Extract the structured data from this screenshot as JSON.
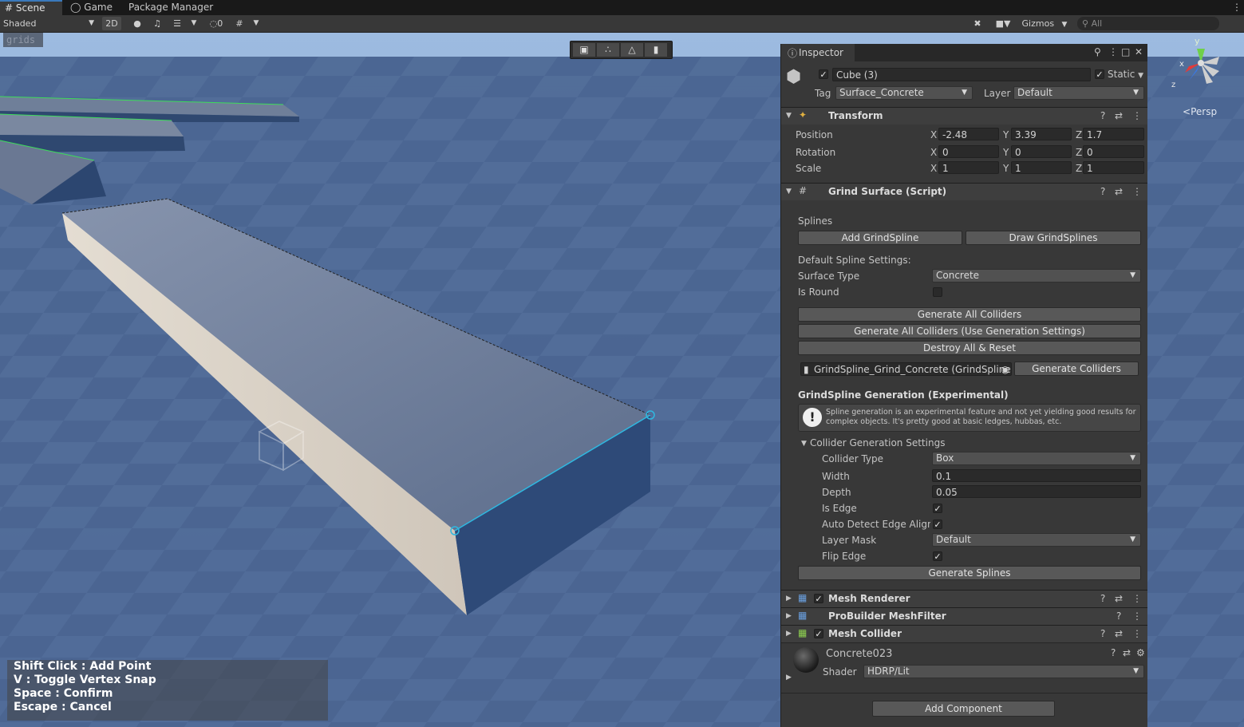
{
  "tabs": [
    {
      "icon": "grid-icon",
      "label": "Scene",
      "active": true
    },
    {
      "icon": "gamepad-icon",
      "label": "Game",
      "active": false
    },
    {
      "icon": "",
      "label": "Package Manager",
      "active": false
    }
  ],
  "toolbar": {
    "shading_mode": "Shaded",
    "toggle_2d": "2D",
    "hidden_count": "0",
    "gizmos_label": "Gizmos",
    "search_placeholder": "All"
  },
  "scene": {
    "overlay_label": "grids",
    "persp_label": "Persp",
    "axis_y": "y",
    "axis_x": "x",
    "axis_z": "z",
    "hints": [
      "Shift Click : Add Point",
      "V : Toggle Vertex Snap",
      "Space : Confirm",
      "Escape : Cancel"
    ]
  },
  "inspector": {
    "tab_label": "Inspector",
    "object_name": "Cube (3)",
    "static_label": "Static",
    "tag_label": "Tag",
    "tag_value": "Surface_Concrete",
    "layer_label": "Layer",
    "layer_value": "Default",
    "transform": {
      "title": "Transform",
      "position_label": "Position",
      "rotation_label": "Rotation",
      "scale_label": "Scale",
      "position": {
        "x": "-2.48",
        "y": "3.39",
        "z": "1.7"
      },
      "rotation": {
        "x": "0",
        "y": "0",
        "z": "0"
      },
      "scale": {
        "x": "1",
        "y": "1",
        "z": "1"
      },
      "x_label": "X",
      "y_label": "Y",
      "z_label": "Z"
    },
    "grind": {
      "title": "Grind Surface (Script)",
      "splines_label": "Splines",
      "add_btn": "Add GrindSpline",
      "draw_btn": "Draw GrindSplines",
      "defaults_label": "Default Spline Settings:",
      "surface_type_label": "Surface Type",
      "surface_type_value": "Concrete",
      "is_round_label": "Is Round",
      "gen_all_btn": "Generate All Colliders",
      "gen_all_settings_btn": "Generate All Colliders (Use Generation Settings)",
      "destroy_btn": "Destroy All & Reset",
      "spline_ref": "GrindSpline_Grind_Concrete (GrindSpline",
      "gen_colliders_btn": "Generate Colliders",
      "generation_title": "GrindSpline Generation (Experimental)",
      "warning_text": "Spline generation is an experimental feature and not yet yielding good results for complex objects. It's pretty good at basic ledges, hubbas, etc.",
      "collider_settings_label": "Collider Generation Settings",
      "collider_type_label": "Collider Type",
      "collider_type_value": "Box",
      "width_label": "Width",
      "width_value": "0.1",
      "depth_label": "Depth",
      "depth_value": "0.05",
      "is_edge_label": "Is Edge",
      "auto_detect_label": "Auto Detect Edge Alignm",
      "layer_mask_label": "Layer Mask",
      "layer_mask_value": "Default",
      "flip_edge_label": "Flip Edge",
      "gen_splines_btn": "Generate Splines",
      "is_round": false,
      "is_edge": true,
      "auto_detect": true,
      "flip_edge": true
    },
    "components": [
      {
        "name": "Mesh Renderer",
        "checked": true
      },
      {
        "name": "ProBuilder MeshFilter",
        "checked": null
      },
      {
        "name": "Mesh Collider",
        "checked": true
      }
    ],
    "material": {
      "name": "Concrete023",
      "shader_label": "Shader",
      "shader_value": "HDRP/Lit"
    },
    "add_component": "Add Component"
  },
  "colors": {
    "accent": "#3a79bb",
    "selection_outline": "#2fb8e0",
    "ledge_edge": "#3ddc5a"
  }
}
